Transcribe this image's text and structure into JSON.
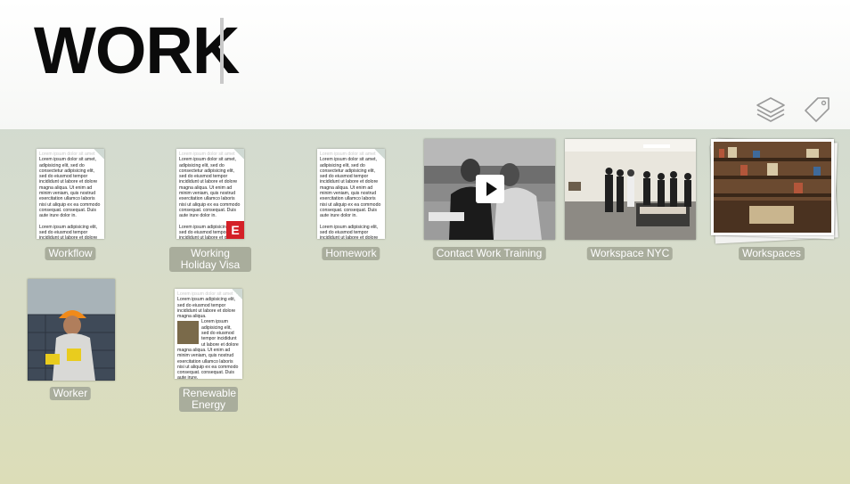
{
  "search": {
    "query": "WORK"
  },
  "header": {
    "icons": [
      "layers-icon",
      "tag-icon"
    ]
  },
  "doc_text": {
    "lines": "Lorem ipsum dolor sit amet, adipisicing elit, sed do consectetur adipisicing elit, sed do eiusmod tempor incididunt ut labore et dolore magna aliqua. Ut enim ad minim veniam, quis nostrud exercitation ullamco laboris nisi ut aliquip ex ea commodo consequat. consequat. Duis aute irure dolor in.",
    "para2": "Lorem ipsum adipisicing elit, sed do eiusmod tempor incididunt ut labore et dolore magna aliqua. Ut enim ad minim veniam, quis nostrud exercitation ullamco laboris nisi ut aliquip ex ea commodo consequat. consequat. Duis aute irure.",
    "para3": "Lorem ipsum adipisicing elit, sed do eiusmod tempor incididunt ut labore et dolore magna aliqua."
  },
  "tiles": [
    {
      "label": "Workflow",
      "type": "document"
    },
    {
      "label": "Working Holiday Visa",
      "type": "document",
      "badge": "E"
    },
    {
      "label": "Homework",
      "type": "document"
    },
    {
      "label": "Contact Work Training",
      "type": "video"
    },
    {
      "label": "Workspace NYC",
      "type": "photo"
    },
    {
      "label": "Workspaces",
      "type": "photo-stack"
    },
    {
      "label": "Worker",
      "type": "photo"
    },
    {
      "label": "Renewable Energy",
      "type": "document"
    }
  ]
}
